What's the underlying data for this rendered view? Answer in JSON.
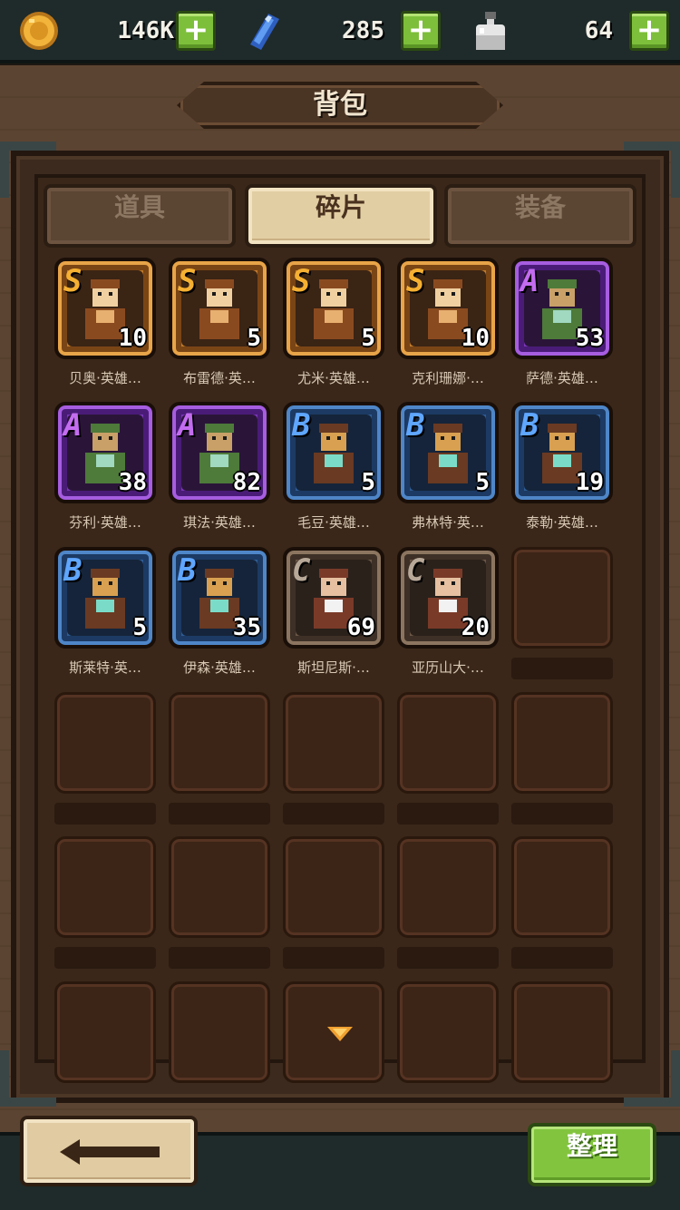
{
  "resources": {
    "gold": {
      "count": "146K",
      "icon": "gold-coin-icon"
    },
    "gem": {
      "count": "285",
      "icon": "blue-gem-icon"
    },
    "potion": {
      "count": "64",
      "icon": "potion-bottle-icon"
    },
    "plus_label": "+"
  },
  "title": "背包",
  "tabs": [
    {
      "label": "道具",
      "active": false
    },
    {
      "label": "碎片",
      "active": true
    },
    {
      "label": "装备",
      "active": false
    }
  ],
  "items": [
    {
      "rank": "S",
      "count": "10",
      "name": "贝奥·英雄…",
      "portrait": "hero-beo-icon"
    },
    {
      "rank": "S",
      "count": "5",
      "name": "布雷德·英…",
      "portrait": "hero-bred-icon"
    },
    {
      "rank": "S",
      "count": "5",
      "name": "尤米·英雄…",
      "portrait": "hero-yumi-icon"
    },
    {
      "rank": "S",
      "count": "10",
      "name": "克利珊娜·…",
      "portrait": "hero-kelishanna-icon"
    },
    {
      "rank": "A",
      "count": "53",
      "name": "萨德·英雄…",
      "portrait": "hero-sade-icon"
    },
    {
      "rank": "A",
      "count": "38",
      "name": "芬利·英雄…",
      "portrait": "hero-fenli-icon"
    },
    {
      "rank": "A",
      "count": "82",
      "name": "琪法·英雄…",
      "portrait": "hero-qifa-icon"
    },
    {
      "rank": "B",
      "count": "5",
      "name": "毛豆·英雄…",
      "portrait": "hero-maodou-icon"
    },
    {
      "rank": "B",
      "count": "5",
      "name": "弗林特·英…",
      "portrait": "hero-flint-icon"
    },
    {
      "rank": "B",
      "count": "19",
      "name": "泰勒·英雄…",
      "portrait": "hero-taylor-icon"
    },
    {
      "rank": "B",
      "count": "5",
      "name": "斯莱特·英…",
      "portrait": "hero-slate-icon"
    },
    {
      "rank": "B",
      "count": "35",
      "name": "伊森·英雄…",
      "portrait": "hero-ethan-icon"
    },
    {
      "rank": "C",
      "count": "69",
      "name": "斯坦尼斯·…",
      "portrait": "hero-stannis-icon"
    },
    {
      "rank": "C",
      "count": "20",
      "name": "亚历山大·…",
      "portrait": "hero-alexander-icon"
    }
  ],
  "buttons": {
    "back_icon": "back-arrow-icon",
    "sort_label": "整理"
  },
  "colors": {
    "rank_S": "#c07a2a",
    "rank_A": "#7a35b8",
    "rank_B": "#2f5c94",
    "rank_C": "#6a5646",
    "accent_green": "#82c43e"
  }
}
